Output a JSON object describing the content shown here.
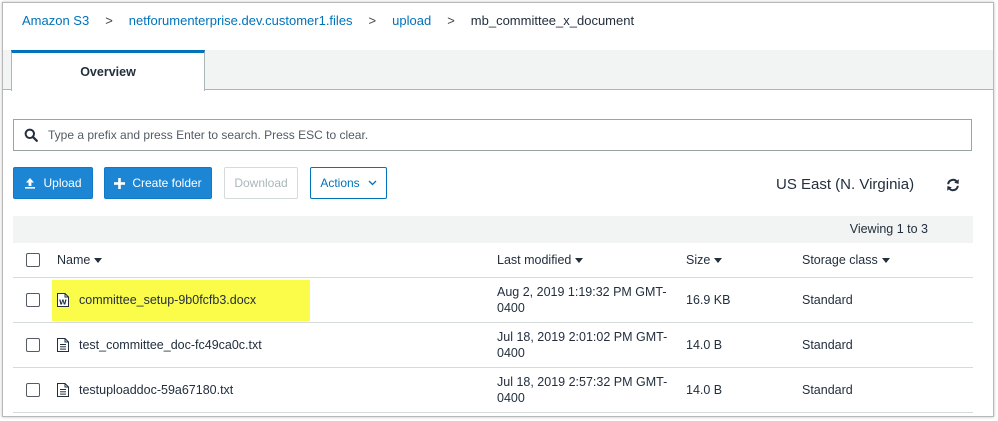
{
  "breadcrumb": {
    "items": [
      "Amazon S3",
      "netforumenterprise.dev.customer1.files",
      "upload"
    ],
    "current": "mb_committee_x_document",
    "separator": ">"
  },
  "tabs": [
    {
      "label": "Overview",
      "active": true
    }
  ],
  "search": {
    "placeholder": "Type a prefix and press Enter to search. Press ESC to clear.",
    "value": "",
    "icon": "search-icon"
  },
  "toolbar": {
    "upload_label": "Upload",
    "create_folder_label": "Create folder",
    "download_label": "Download",
    "actions_label": "Actions"
  },
  "region": {
    "label": "US East (N. Virginia)"
  },
  "table": {
    "viewing": "Viewing 1 to 3",
    "columns": {
      "name": "Name",
      "last_modified": "Last modified",
      "size": "Size",
      "storage_class": "Storage class"
    },
    "rows": [
      {
        "name": "committee_setup-9b0fcfb3.docx",
        "modified_line1": "Aug 2, 2019 1:19:32 PM GMT-",
        "modified_line2": "0400",
        "size": "16.9 KB",
        "storage_class": "Standard",
        "icon": "word-doc-icon",
        "highlighted": true
      },
      {
        "name": "test_committee_doc-fc49ca0c.txt",
        "modified_line1": "Jul 18, 2019 2:01:02 PM GMT-",
        "modified_line2": "0400",
        "size": "14.0 B",
        "storage_class": "Standard",
        "icon": "text-file-icon",
        "highlighted": false
      },
      {
        "name": "testuploaddoc-59a67180.txt",
        "modified_line1": "Jul 18, 2019 2:57:32 PM GMT-",
        "modified_line2": "0400",
        "size": "14.0 B",
        "storage_class": "Standard",
        "icon": "text-file-icon",
        "highlighted": false
      }
    ]
  },
  "colors": {
    "link": "#0073bb",
    "primary_button": "#1c85d4",
    "highlight": "#fbfc4a",
    "text": "#232f3e"
  }
}
